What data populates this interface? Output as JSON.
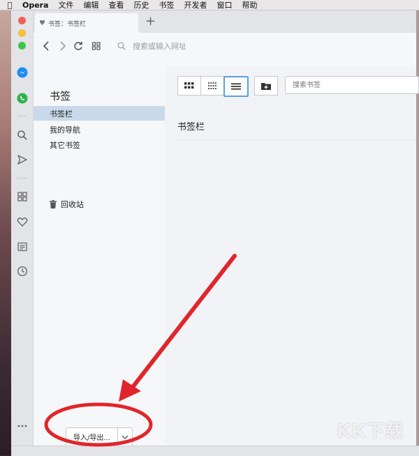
{
  "menubar": {
    "app": "Opera",
    "items": [
      "文件",
      "编辑",
      "查看",
      "历史",
      "书签",
      "开发者",
      "窗口",
      "帮助"
    ]
  },
  "tab": {
    "title": "书签：书签栏"
  },
  "address": {
    "placeholder": "搜索或输入网址"
  },
  "panel": {
    "title": "书签",
    "folders": [
      "书签栏",
      "我的导航",
      "其它书签"
    ],
    "selected": 0,
    "trash": "回收站",
    "import_export": "导入/导出..."
  },
  "content": {
    "search_placeholder": "搜索书签",
    "heading": "书签栏",
    "active_view": "list"
  },
  "watermark": "KK下载",
  "colors": {
    "accent": "#5b9ee0",
    "selection": "#c9d9ea",
    "annotation": "#e0262b"
  }
}
